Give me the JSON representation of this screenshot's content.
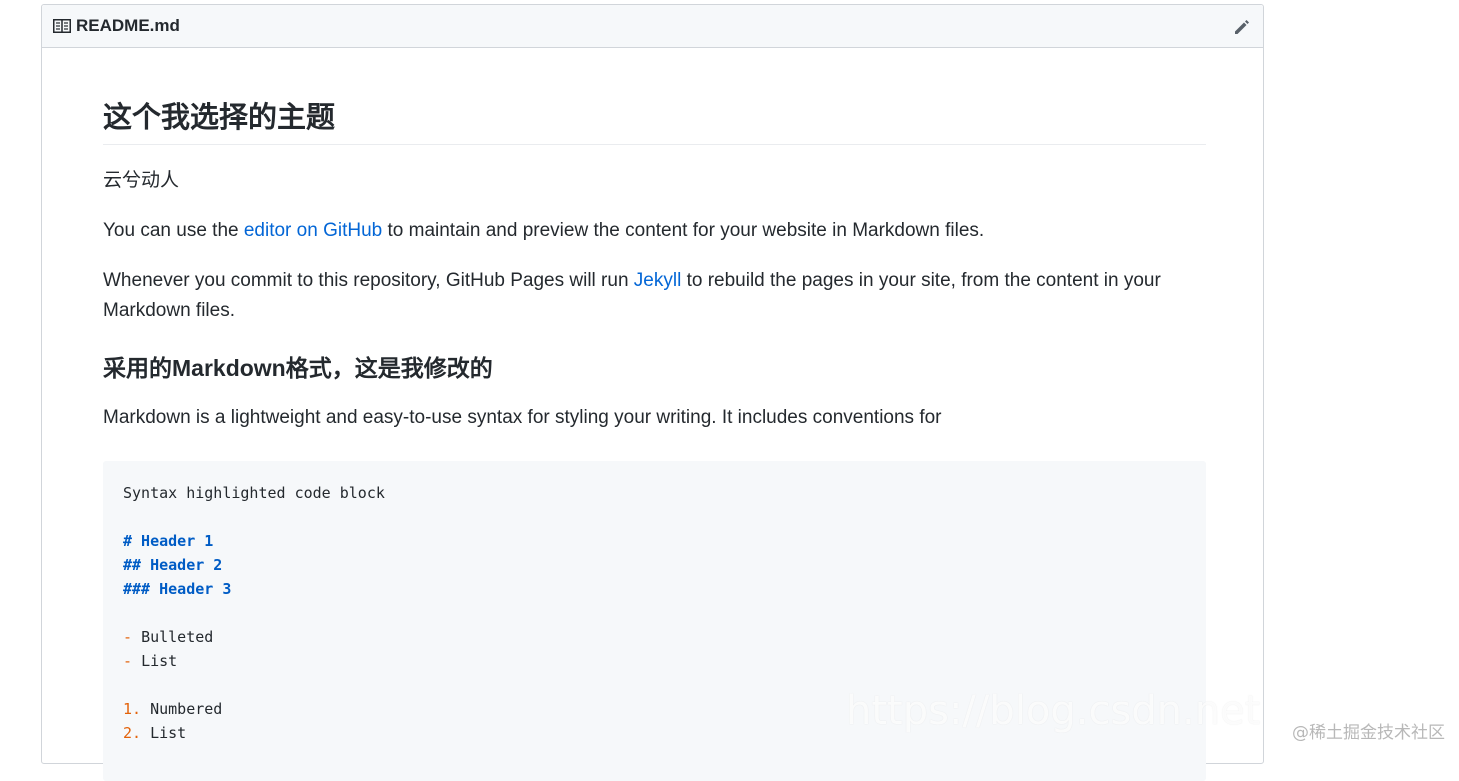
{
  "readme": {
    "title": "README.md"
  },
  "content": {
    "h1": "这个我选择的主题",
    "p1": "云兮动人",
    "p2_before": "You can use the ",
    "p2_link": "editor on GitHub",
    "p2_after": " to maintain and preview the content for your website in Markdown files.",
    "p3_before": "Whenever you commit to this repository, GitHub Pages will run ",
    "p3_link": "Jekyll",
    "p3_after": " to rebuild the pages in your site, from the content in your Markdown files.",
    "h2": "采用的Markdown格式，这是我修改的",
    "p4": "Markdown is a lightweight and easy-to-use syntax for styling your writing. It includes conventions for"
  },
  "code": {
    "line1": "Syntax highlighted code block",
    "h1": "# Header 1",
    "h2": "## Header 2",
    "h3": "### Header 3",
    "bullet_marker": "- ",
    "bullet1": "Bulleted",
    "bullet2": "List",
    "num1_marker": "1. ",
    "num1": "Numbered",
    "num2_marker": "2. ",
    "num2": "List"
  },
  "watermark": {
    "url": "https://blog.csdn.net",
    "site": "@稀土掘金技术社区"
  },
  "colors": {
    "link": "#0366d6",
    "code_header": "#005cc5",
    "code_marker": "#e36209",
    "header_bg": "#f6f8fa"
  },
  "icons": {
    "header": "book-icon",
    "edit": "pencil-icon"
  }
}
